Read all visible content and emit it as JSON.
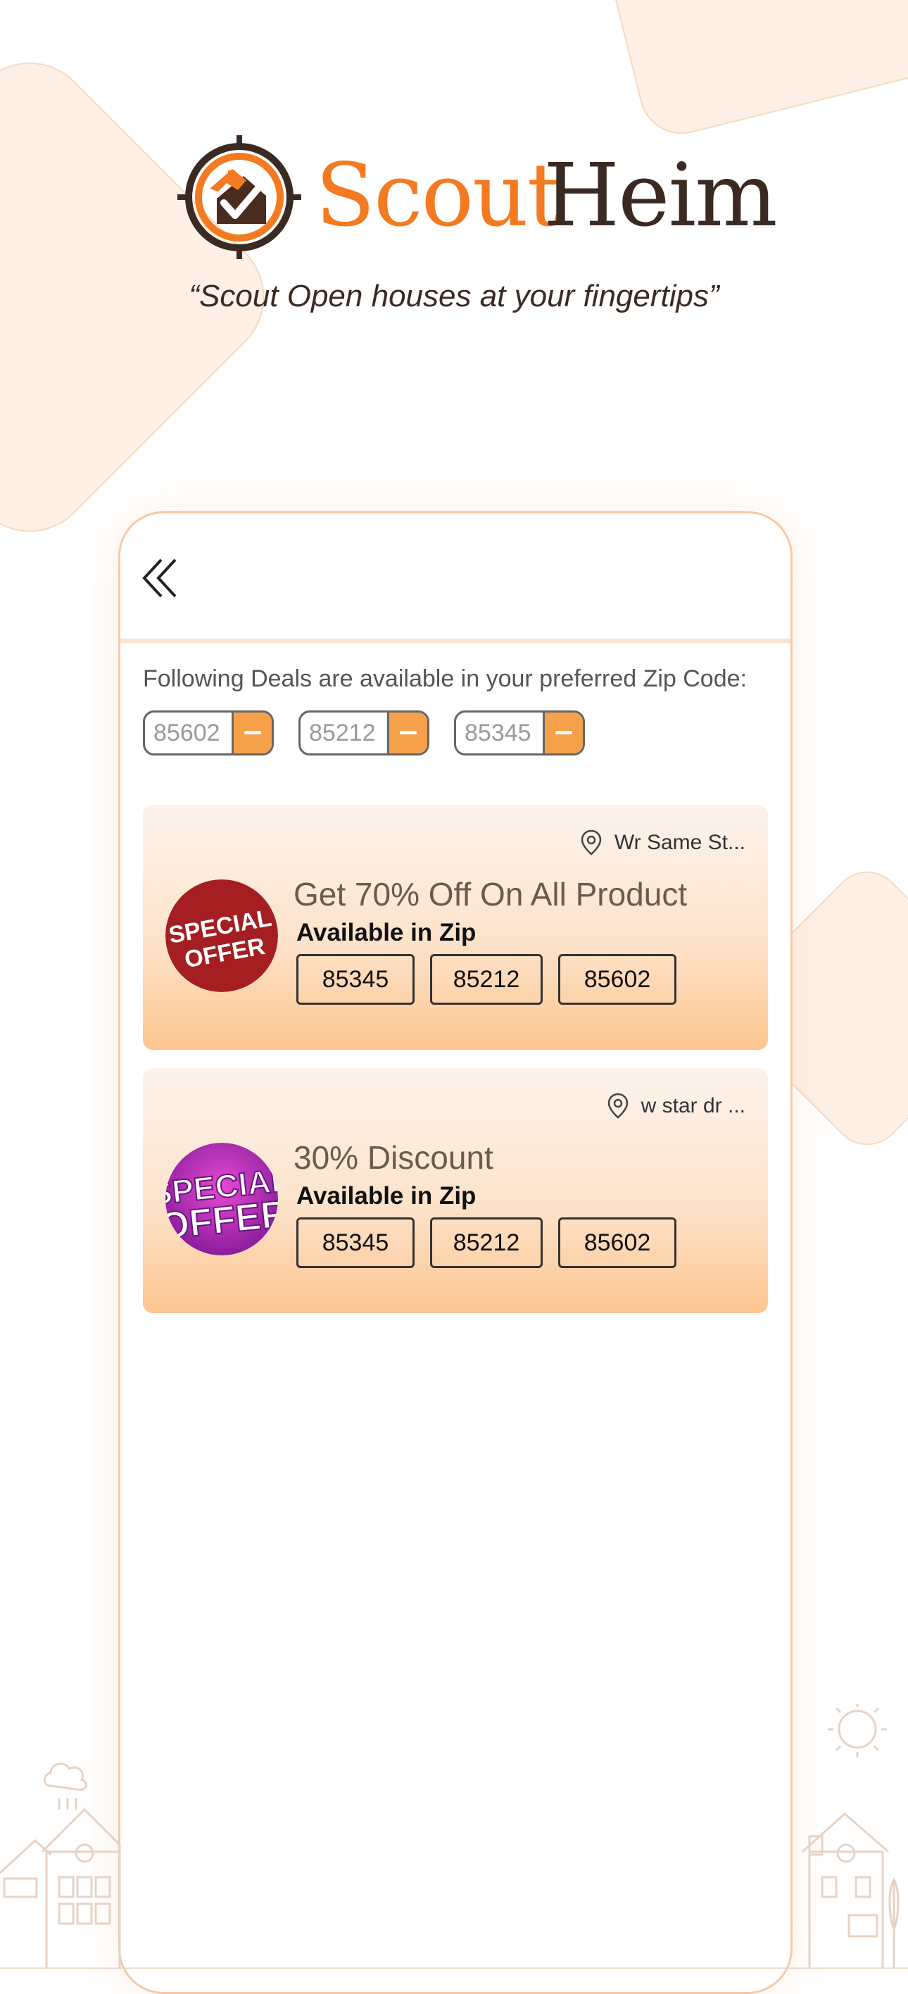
{
  "brand": {
    "name_part1": "Scout",
    "name_part2": "Heim",
    "tagline": "“Scout Open houses at your fingertips”"
  },
  "intro": "Following Deals are available in your preferred Zip Code:",
  "preferred_zips": [
    "85602",
    "85212",
    "85345"
  ],
  "deals": [
    {
      "location": "Wr Same St...",
      "badge_icon": "special-offer-red-badge",
      "title": "Get 70% Off On All Product",
      "available_label": "Available in Zip",
      "zips": [
        "85345",
        "85212",
        "85602"
      ]
    },
    {
      "location": "w star dr ...",
      "badge_icon": "special-offer-purple-badge",
      "title": "30% Discount",
      "available_label": "Available in Zip",
      "zips": [
        "85345",
        "85212",
        "85602"
      ]
    }
  ],
  "badges": {
    "red": {
      "line1": "SPECIAL",
      "line2": "OFFER"
    },
    "purple": {
      "line1": "SPECIAL",
      "line2": "OFFER"
    }
  },
  "colors": {
    "accent": "#f47a22",
    "brand_dark": "#3b2a22",
    "zip_remove": "#f7a04a",
    "card_border": "#f7c9a6"
  }
}
